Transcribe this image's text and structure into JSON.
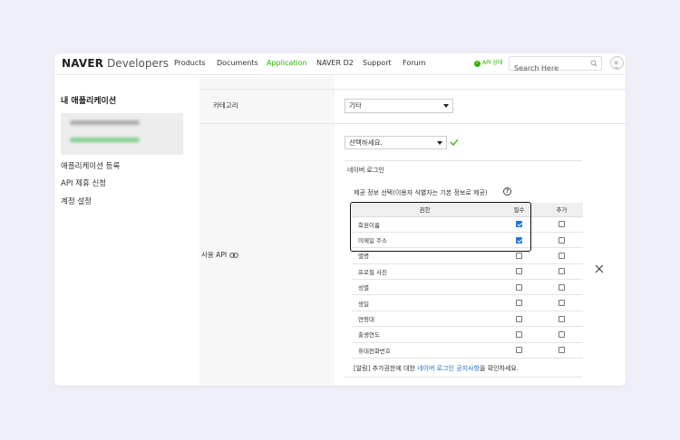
{
  "header": {
    "brand_bold": "NAVER",
    "brand_light": " Developers",
    "nav": [
      "Products",
      "Documents",
      "Application",
      "NAVER D2",
      "Support",
      "Forum"
    ],
    "active_nav": "Application",
    "api_status": "API 상태",
    "search_placeholder": "Search Here"
  },
  "sidebar": {
    "title": "내 애플리케이션",
    "links": [
      "애플리케이션 등록",
      "API 제휴 신청",
      "계정 설정"
    ]
  },
  "form": {
    "category_label": "카테고리",
    "category_value": "기타",
    "api_label": "사용 API",
    "api_select_value": "선택하세요.",
    "api_section_title": "네이버 로그인",
    "perm_caption": "제공 정보 선택(이용자 식별자는 기본 정보로 제공)",
    "help_glyph": "?",
    "table": {
      "headers": [
        "권한",
        "필수",
        "추가"
      ],
      "rows": [
        {
          "name": "회원이름",
          "required": true,
          "extra": false
        },
        {
          "name": "이메일 주소",
          "required": true,
          "extra": false
        },
        {
          "name": "별명",
          "required": false,
          "extra": false
        },
        {
          "name": "프로필 사진",
          "required": false,
          "extra": false
        },
        {
          "name": "성별",
          "required": false,
          "extra": false
        },
        {
          "name": "생일",
          "required": false,
          "extra": false
        },
        {
          "name": "연령대",
          "required": false,
          "extra": false
        },
        {
          "name": "출생연도",
          "required": false,
          "extra": false
        },
        {
          "name": "휴대전화번호",
          "required": false,
          "extra": false
        }
      ]
    },
    "notice_prefix": "[알림] 추가권한에 대한 ",
    "notice_link": "네이버 로그인 공지사항",
    "notice_suffix": "을 확인하세요."
  },
  "colors": {
    "accent_green": "#2db400",
    "link_blue": "#1a6fd1",
    "checkbox_blue": "#1a73e8",
    "page_bg": "#eeeef9"
  }
}
